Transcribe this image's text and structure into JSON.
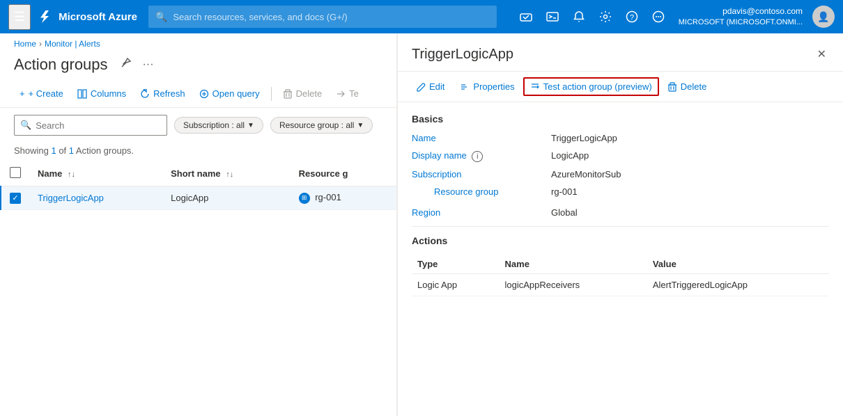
{
  "topnav": {
    "hamburger": "☰",
    "logo_text": "Microsoft Azure",
    "search_placeholder": "Search resources, services, and docs (G+/)",
    "user_email": "pdavis@contoso.com",
    "user_tenant": "MICROSOFT (MICROSOFT.ONMI...",
    "icons": {
      "cloud": "⬛",
      "terminal": "⬛",
      "bell": "🔔",
      "gear": "⚙",
      "help": "❓",
      "feedback": "💬"
    }
  },
  "breadcrumb": {
    "home": "Home",
    "monitor": "Monitor | Alerts"
  },
  "page": {
    "title": "Action groups",
    "pin_icon": "📌",
    "more_icon": "···"
  },
  "toolbar": {
    "create": "+ Create",
    "columns": "Columns",
    "refresh": "Refresh",
    "open_query": "Open query",
    "delete": "Delete",
    "te_label": "Te"
  },
  "filters": {
    "search_placeholder": "Search",
    "subscription_label": "Subscription : all",
    "resource_group_label": "Resource group : all"
  },
  "showing": {
    "text_prefix": "Showing ",
    "current": "1",
    "separator": " of ",
    "total": "1",
    "text_suffix": " Action groups."
  },
  "table": {
    "columns": [
      "Name",
      "Short name",
      "Resource g"
    ],
    "rows": [
      {
        "name": "TriggerLogicApp",
        "short_name": "LogicApp",
        "resource_group": "rg-001",
        "selected": true
      }
    ]
  },
  "right_panel": {
    "title": "TriggerLogicApp",
    "toolbar": {
      "edit": "Edit",
      "properties": "Properties",
      "test_action_group": "Test action group (preview)",
      "delete": "Delete"
    },
    "basics_section": "Basics",
    "fields": [
      {
        "label": "Name",
        "value": "TriggerLogicApp",
        "indent": false
      },
      {
        "label": "Display name",
        "value": "LogicApp",
        "indent": false,
        "info": true
      },
      {
        "label": "Subscription",
        "value": "AzureMonitorSub",
        "indent": false
      },
      {
        "label": "Resource group",
        "value": "rg-001",
        "indent": true
      },
      {
        "label": "Region",
        "value": "Global",
        "indent": false
      }
    ],
    "actions_section": "Actions",
    "actions_columns": [
      "Type",
      "Name",
      "Value"
    ],
    "actions_rows": [
      {
        "type": "Logic App",
        "name": "logicAppReceivers",
        "value": "AlertTriggeredLogicApp"
      }
    ]
  }
}
